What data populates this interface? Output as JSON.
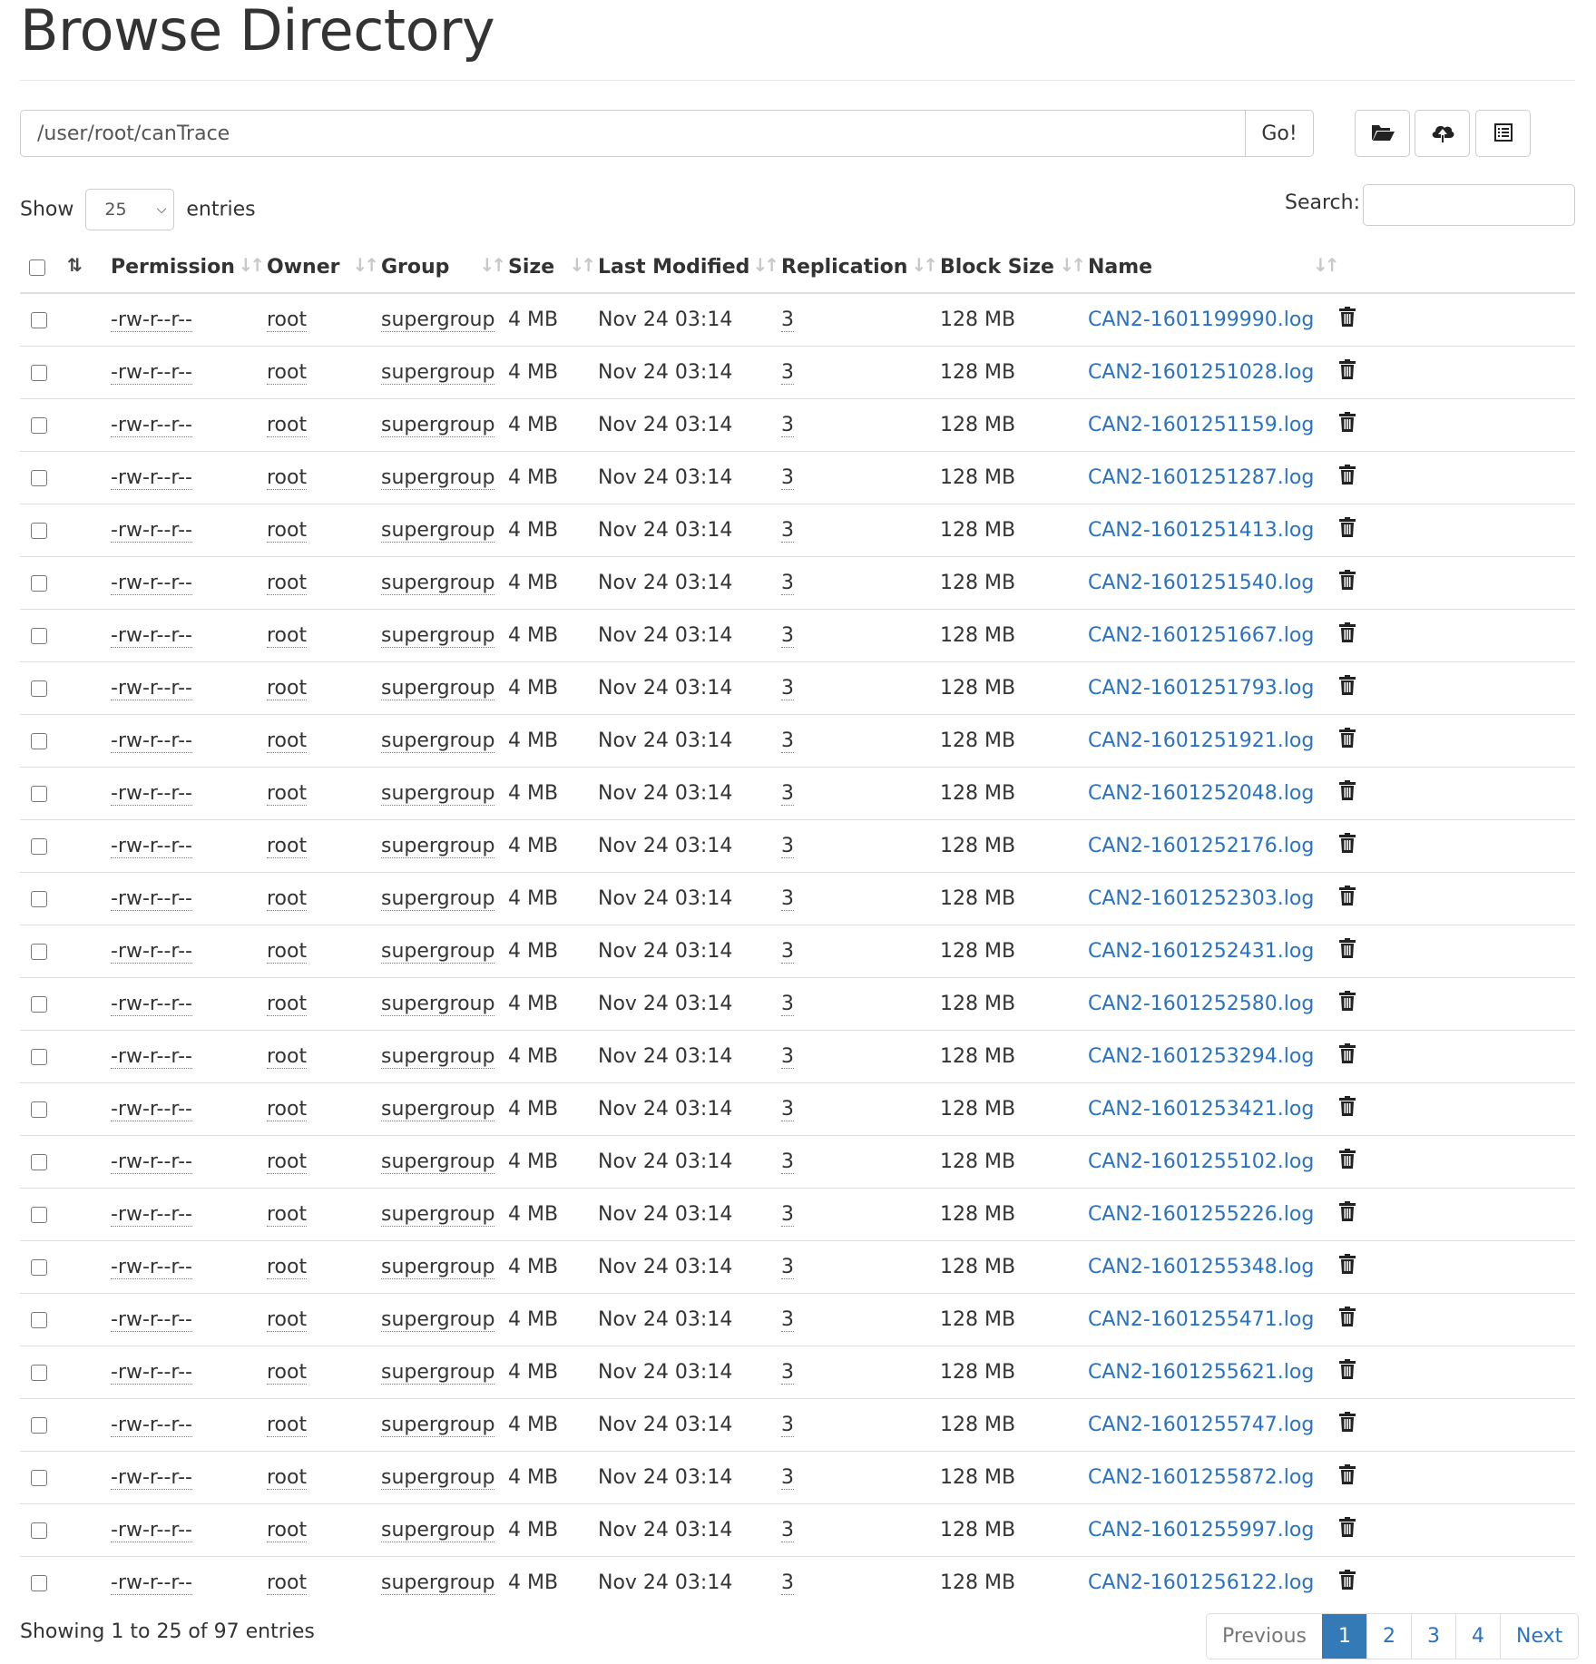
{
  "page": {
    "title": "Browse Directory"
  },
  "path_bar": {
    "value": "/user/root/canTrace",
    "go_label": "Go!"
  },
  "toolbar": {
    "icons": [
      "folder-open-icon",
      "cloud-upload-icon",
      "list-alt-icon"
    ]
  },
  "length_menu": {
    "show_label": "Show",
    "selected": "25",
    "entries_label": "entries"
  },
  "search": {
    "label": "Search:",
    "value": ""
  },
  "table": {
    "columns": [
      "Permission",
      "Owner",
      "Group",
      "Size",
      "Last Modified",
      "Replication",
      "Block Size",
      "Name"
    ],
    "rows": [
      [
        "-rw-r--r--",
        "root",
        "supergroup",
        "4 MB",
        "Nov 24 03:14",
        "3",
        "128 MB",
        "CAN2-1601199990.log"
      ],
      [
        "-rw-r--r--",
        "root",
        "supergroup",
        "4 MB",
        "Nov 24 03:14",
        "3",
        "128 MB",
        "CAN2-1601251028.log"
      ],
      [
        "-rw-r--r--",
        "root",
        "supergroup",
        "4 MB",
        "Nov 24 03:14",
        "3",
        "128 MB",
        "CAN2-1601251159.log"
      ],
      [
        "-rw-r--r--",
        "root",
        "supergroup",
        "4 MB",
        "Nov 24 03:14",
        "3",
        "128 MB",
        "CAN2-1601251287.log"
      ],
      [
        "-rw-r--r--",
        "root",
        "supergroup",
        "4 MB",
        "Nov 24 03:14",
        "3",
        "128 MB",
        "CAN2-1601251413.log"
      ],
      [
        "-rw-r--r--",
        "root",
        "supergroup",
        "4 MB",
        "Nov 24 03:14",
        "3",
        "128 MB",
        "CAN2-1601251540.log"
      ],
      [
        "-rw-r--r--",
        "root",
        "supergroup",
        "4 MB",
        "Nov 24 03:14",
        "3",
        "128 MB",
        "CAN2-1601251667.log"
      ],
      [
        "-rw-r--r--",
        "root",
        "supergroup",
        "4 MB",
        "Nov 24 03:14",
        "3",
        "128 MB",
        "CAN2-1601251793.log"
      ],
      [
        "-rw-r--r--",
        "root",
        "supergroup",
        "4 MB",
        "Nov 24 03:14",
        "3",
        "128 MB",
        "CAN2-1601251921.log"
      ],
      [
        "-rw-r--r--",
        "root",
        "supergroup",
        "4 MB",
        "Nov 24 03:14",
        "3",
        "128 MB",
        "CAN2-1601252048.log"
      ],
      [
        "-rw-r--r--",
        "root",
        "supergroup",
        "4 MB",
        "Nov 24 03:14",
        "3",
        "128 MB",
        "CAN2-1601252176.log"
      ],
      [
        "-rw-r--r--",
        "root",
        "supergroup",
        "4 MB",
        "Nov 24 03:14",
        "3",
        "128 MB",
        "CAN2-1601252303.log"
      ],
      [
        "-rw-r--r--",
        "root",
        "supergroup",
        "4 MB",
        "Nov 24 03:14",
        "3",
        "128 MB",
        "CAN2-1601252431.log"
      ],
      [
        "-rw-r--r--",
        "root",
        "supergroup",
        "4 MB",
        "Nov 24 03:14",
        "3",
        "128 MB",
        "CAN2-1601252580.log"
      ],
      [
        "-rw-r--r--",
        "root",
        "supergroup",
        "4 MB",
        "Nov 24 03:14",
        "3",
        "128 MB",
        "CAN2-1601253294.log"
      ],
      [
        "-rw-r--r--",
        "root",
        "supergroup",
        "4 MB",
        "Nov 24 03:14",
        "3",
        "128 MB",
        "CAN2-1601253421.log"
      ],
      [
        "-rw-r--r--",
        "root",
        "supergroup",
        "4 MB",
        "Nov 24 03:14",
        "3",
        "128 MB",
        "CAN2-1601255102.log"
      ],
      [
        "-rw-r--r--",
        "root",
        "supergroup",
        "4 MB",
        "Nov 24 03:14",
        "3",
        "128 MB",
        "CAN2-1601255226.log"
      ],
      [
        "-rw-r--r--",
        "root",
        "supergroup",
        "4 MB",
        "Nov 24 03:14",
        "3",
        "128 MB",
        "CAN2-1601255348.log"
      ],
      [
        "-rw-r--r--",
        "root",
        "supergroup",
        "4 MB",
        "Nov 24 03:14",
        "3",
        "128 MB",
        "CAN2-1601255471.log"
      ],
      [
        "-rw-r--r--",
        "root",
        "supergroup",
        "4 MB",
        "Nov 24 03:14",
        "3",
        "128 MB",
        "CAN2-1601255621.log"
      ],
      [
        "-rw-r--r--",
        "root",
        "supergroup",
        "4 MB",
        "Nov 24 03:14",
        "3",
        "128 MB",
        "CAN2-1601255747.log"
      ],
      [
        "-rw-r--r--",
        "root",
        "supergroup",
        "4 MB",
        "Nov 24 03:14",
        "3",
        "128 MB",
        "CAN2-1601255872.log"
      ],
      [
        "-rw-r--r--",
        "root",
        "supergroup",
        "4 MB",
        "Nov 24 03:14",
        "3",
        "128 MB",
        "CAN2-1601255997.log"
      ],
      [
        "-rw-r--r--",
        "root",
        "supergroup",
        "4 MB",
        "Nov 24 03:14",
        "3",
        "128 MB",
        "CAN2-1601256122.log"
      ]
    ],
    "row_icon": "trash-icon"
  },
  "footer": {
    "info": "Showing 1 to 25 of 97 entries",
    "pagination": {
      "previous": "Previous",
      "pages": [
        "1",
        "2",
        "3",
        "4"
      ],
      "active": "1",
      "next": "Next"
    }
  },
  "colors": {
    "link": "#2a72c2",
    "active_page": "#337ab7",
    "text": "#333333",
    "border": "#dddddd"
  }
}
